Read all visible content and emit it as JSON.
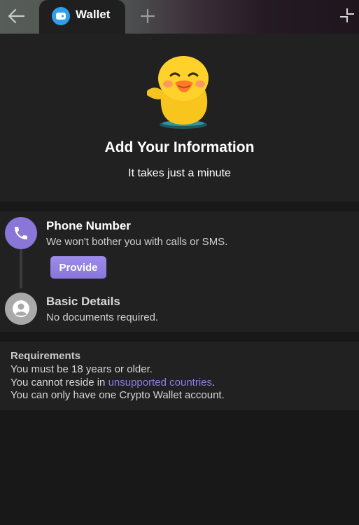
{
  "titlebar": {
    "tab_label": "Wallet",
    "icons": {
      "back": "arrow-left-icon",
      "tab": "wallet-icon",
      "new_tab": "plus-icon",
      "minimize": "minimize-icon"
    }
  },
  "hero": {
    "title": "Add Your Information",
    "subtitle": "It takes just a minute"
  },
  "steps": [
    {
      "title": "Phone Number",
      "description": "We won't bother you with calls or SMS.",
      "button_label": "Provide",
      "icon": "phone-icon"
    },
    {
      "title": "Basic Details",
      "description": "No documents required.",
      "icon": "user-icon"
    }
  ],
  "requirements": {
    "title": "Requirements",
    "line1": "You must be 18 years or older.",
    "line2_prefix": "You cannot reside in ",
    "line2_link": "unsupported countries",
    "line2_suffix": ".",
    "line3": "You can only have one Crypto Wallet account."
  },
  "colors": {
    "accent": "#8a76d6",
    "link": "#8d7ee0",
    "background": "#181818",
    "panel": "#212121"
  }
}
